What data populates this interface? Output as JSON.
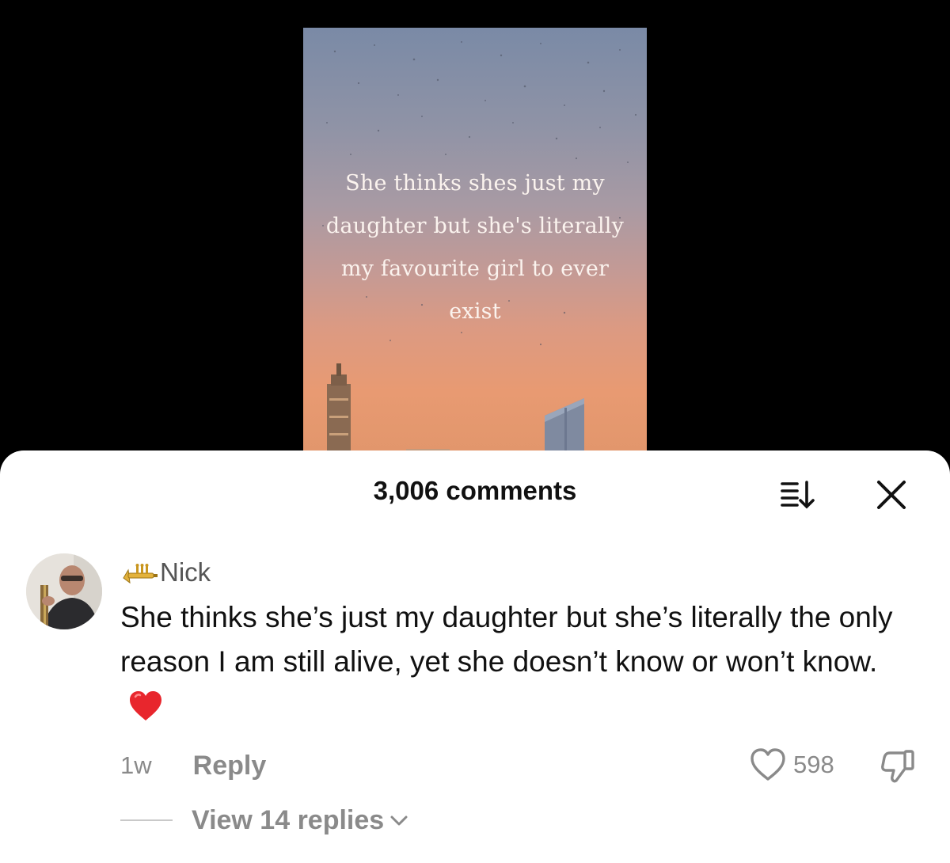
{
  "video": {
    "overlay_text": "She thinks shes just my\ndaughter but she's literally\nmy favourite girl to ever\nexist"
  },
  "sheet": {
    "title": "3,006 comments",
    "sort_icon": "sort-icon",
    "close_icon": "close-icon"
  },
  "comment": {
    "avatar_icon": "avatar",
    "badge_icon": "trumpet-icon",
    "username": "Nick",
    "text": "She thinks she’s just my daughter but she’s literally the only reason I am still alive, yet she doesn’t know or won’t know.",
    "emoji": "heart-icon",
    "timestamp": "1w",
    "reply_label": "Reply",
    "like_count": "598",
    "like_icon": "heart-outline-icon",
    "dislike_icon": "thumbs-down-icon",
    "view_replies_label": "View 14 replies"
  },
  "colors": {
    "heart_red": "#e8262d",
    "muted_text": "#8a8a8a",
    "primary_text": "#111111",
    "sheet_background": "#ffffff",
    "page_background": "#000000"
  }
}
